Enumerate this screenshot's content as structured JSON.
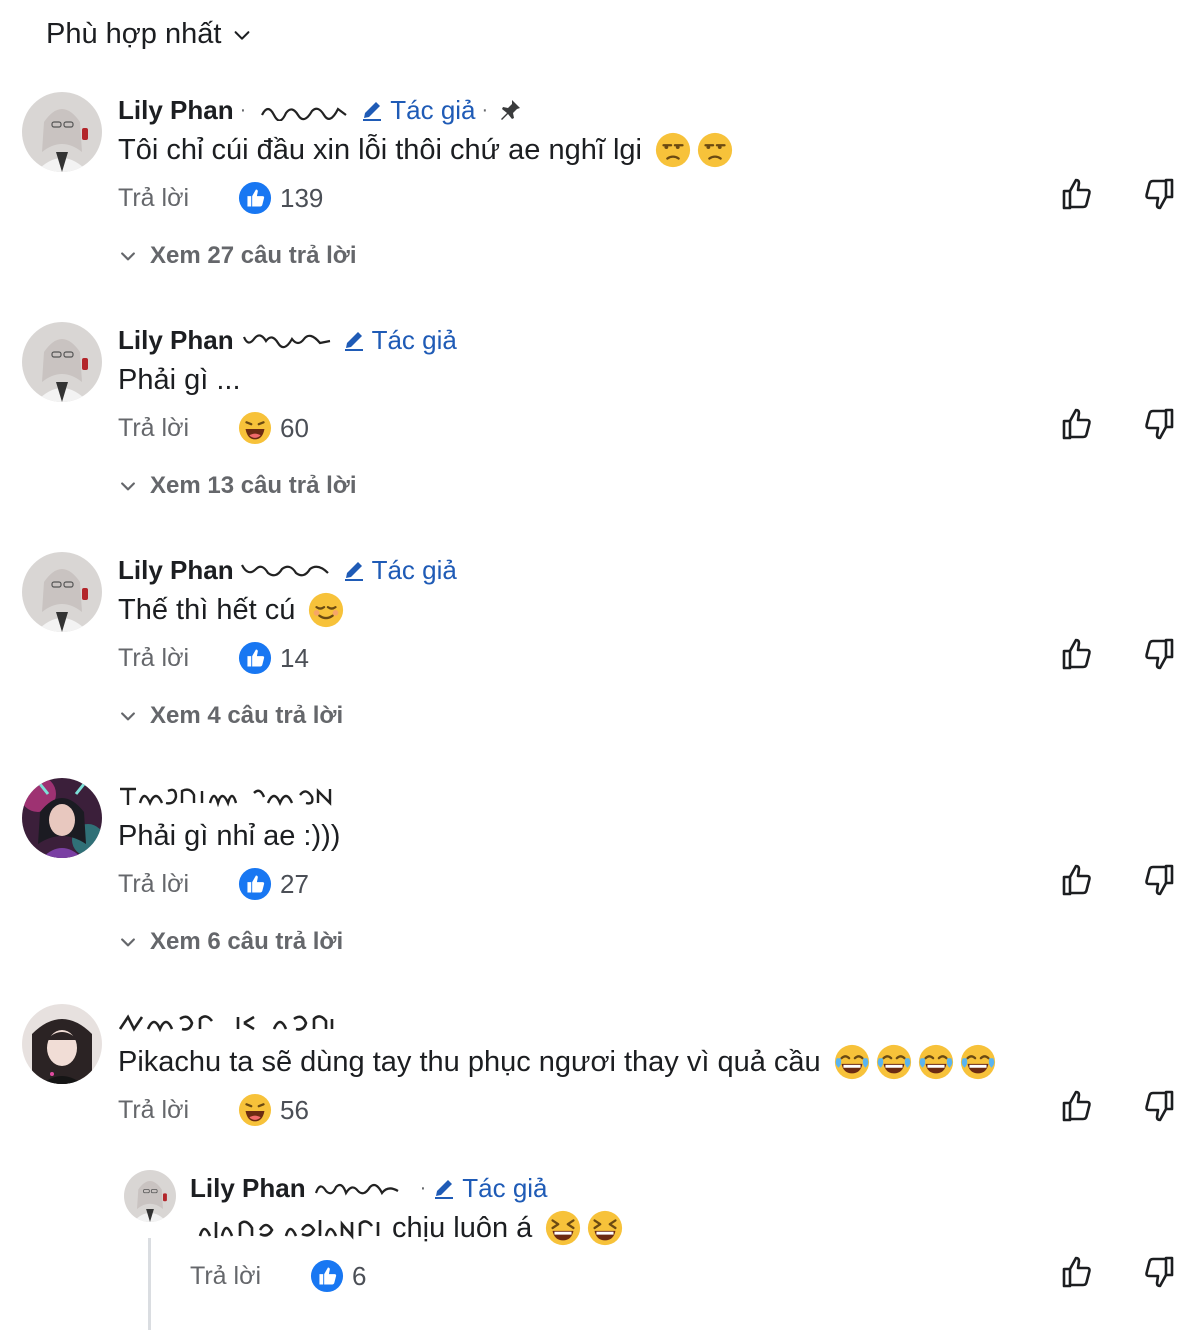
{
  "sort": {
    "label": "Phù hợp nhất"
  },
  "colors": {
    "author_blue": "#1f5bb6",
    "gray_text": "#65676b",
    "like_blue": "#1877f2"
  },
  "comments": [
    {
      "author": "Lily Phan",
      "author_badge": "Tác giả",
      "pinned": true,
      "text": "Tôi chỉ cúi đầu xin lỗi thôi chứ ae nghĩ lgi",
      "emojis": [
        "unamused-face",
        "unamused-face"
      ],
      "reply_label": "Trả lời",
      "reaction": {
        "icon": "like-icon",
        "count": "139"
      },
      "view_replies": "Xem 27 câu trả lời"
    },
    {
      "author": "Lily Phan",
      "author_badge": "Tác giả",
      "text": "Phải gì ...",
      "emojis": [],
      "reply_label": "Trả lời",
      "reaction": {
        "icon": "haha-icon",
        "count": "60"
      },
      "view_replies": "Xem 13 câu trả lời"
    },
    {
      "author": "Lily Phan",
      "author_badge": "Tác giả",
      "text": "Thế thì hết cú",
      "emojis": [
        "relieved-face"
      ],
      "reply_label": "Trả lời",
      "reaction": {
        "icon": "like-icon",
        "count": "14"
      },
      "view_replies": "Xem 4 câu trả lời"
    },
    {
      "author": "",
      "text": "Phải gì nhỉ ae :)))",
      "emojis": [],
      "reply_label": "Trả lời",
      "reaction": {
        "icon": "like-icon",
        "count": "27"
      },
      "view_replies": "Xem 6 câu trả lời"
    },
    {
      "author": "",
      "text": "Pikachu ta sẽ dùng tay thu phục ngươi thay vì quả cầu",
      "emojis": [
        "tears-of-joy-face",
        "tears-of-joy-face",
        "tears-of-joy-face",
        "tears-of-joy-face"
      ],
      "reply_label": "Trả lời",
      "reaction": {
        "icon": "haha-icon",
        "count": "56"
      }
    }
  ],
  "reply": {
    "author": "Lily Phan",
    "author_badge": "Tác giả",
    "text": "chịu luôn á",
    "emojis": [
      "grinning-squinting-face",
      "grinning-squinting-face"
    ],
    "reply_label": "Trả lời",
    "reaction": {
      "icon": "like-icon",
      "count": "6"
    }
  }
}
